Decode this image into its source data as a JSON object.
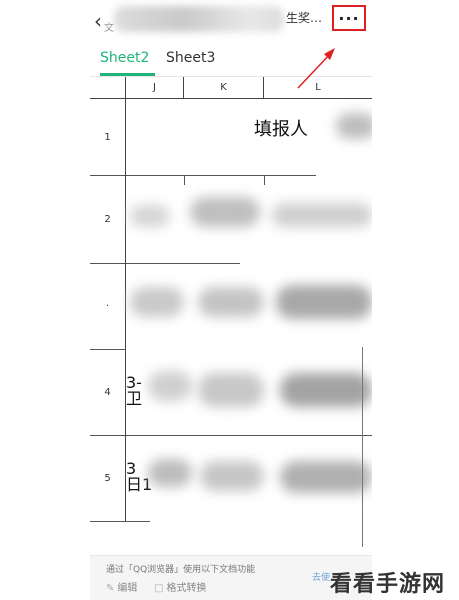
{
  "topbar": {
    "back_icon": "chevron-left-icon",
    "title_prefix": "文",
    "title_suffix": "生奖…",
    "more_label": "···",
    "highlight_color": "#e02020"
  },
  "tabs": [
    {
      "label": "Sheet2",
      "active": true
    },
    {
      "label": "Sheet3",
      "active": false
    }
  ],
  "accent_color": "#1fb57a",
  "columns": [
    "J",
    "K",
    "L"
  ],
  "rows": [
    {
      "num": "1",
      "text": "填报人"
    },
    {
      "num": "2"
    },
    {
      "num": "·"
    },
    {
      "num": "4",
      "partial": "3-\n卫"
    },
    {
      "num": "5",
      "partial": "3\n日1"
    }
  ],
  "bottom": {
    "hint": "通过「QQ浏览器」使用以下文档功能",
    "edit_label": "编辑",
    "convert_label": "格式转换",
    "right_label": "去使"
  },
  "watermark": "看看手游网"
}
